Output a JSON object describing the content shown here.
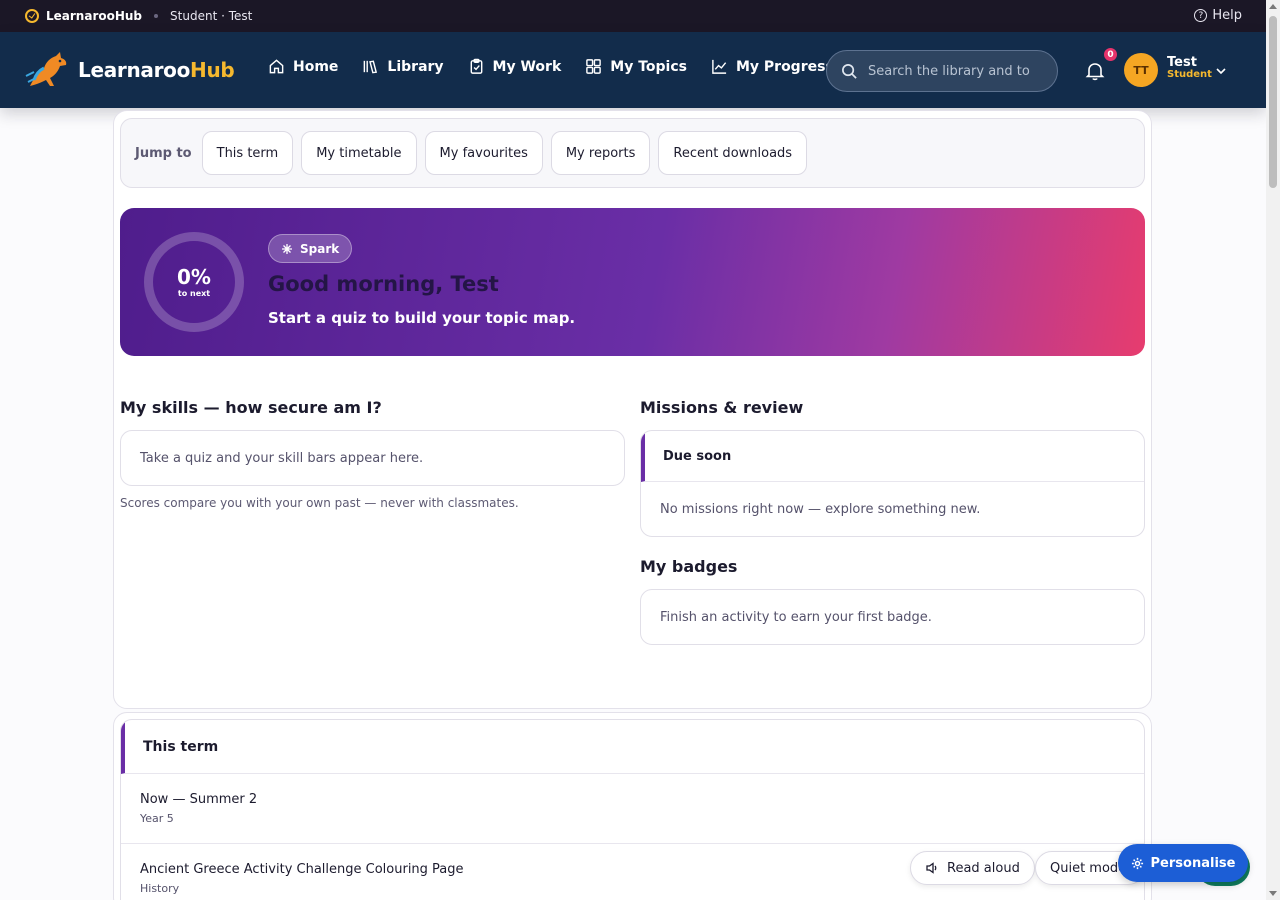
{
  "topbar": {
    "brand": "LearnarooHub",
    "context": "Student · Test",
    "help": "Help"
  },
  "nav": {
    "brand_main": "Learnaroo",
    "brand_accent": "Hub",
    "items": [
      {
        "label": "Home",
        "icon": "home-icon"
      },
      {
        "label": "Library",
        "icon": "library-icon"
      },
      {
        "label": "My Work",
        "icon": "clipboard-icon"
      },
      {
        "label": "My Topics",
        "icon": "grid-icon"
      },
      {
        "label": "My Progress",
        "icon": "chart-icon"
      }
    ],
    "search_placeholder": "Search the library and to",
    "notifications": "0",
    "user": {
      "initials": "TT",
      "name": "Test",
      "role": "Student"
    }
  },
  "jump": {
    "label": "Jump to",
    "chips": [
      "This term",
      "My timetable",
      "My favourites",
      "My reports",
      "Recent downloads"
    ]
  },
  "hero": {
    "progress_percent": 0,
    "progress_label": "0%",
    "progress_sub": "to next",
    "pill": "Spark",
    "greeting": "Good morning, Test",
    "subtitle": "Start a quiz to build your topic map."
  },
  "skills": {
    "title": "My skills — how secure am I?",
    "empty": "Take a quiz and your skill bars appear here.",
    "note": "Scores compare you with your own past — never with classmates."
  },
  "missions": {
    "title": "Missions & review",
    "due_title": "Due soon",
    "empty": "No missions right now — explore something new."
  },
  "badges": {
    "title": "My badges",
    "empty": "Finish an activity to earn your first badge."
  },
  "term": {
    "title": "This term",
    "rows": [
      {
        "title": "Now — Summer 2",
        "sub": "Year 5"
      },
      {
        "title": "Ancient Greece Activity Challenge Colouring Page",
        "sub": "History"
      }
    ]
  },
  "floating": {
    "read_aloud": "Read aloud",
    "quiet_mode": "Quiet mode",
    "personalise": "Personalise"
  },
  "colors": {
    "nav_bg": "#122c4b",
    "accent": "#f5b82e",
    "brand_purple": "#6a2ea6",
    "hero_end": "#e73c6e",
    "primary_button": "#1c5ed6"
  }
}
